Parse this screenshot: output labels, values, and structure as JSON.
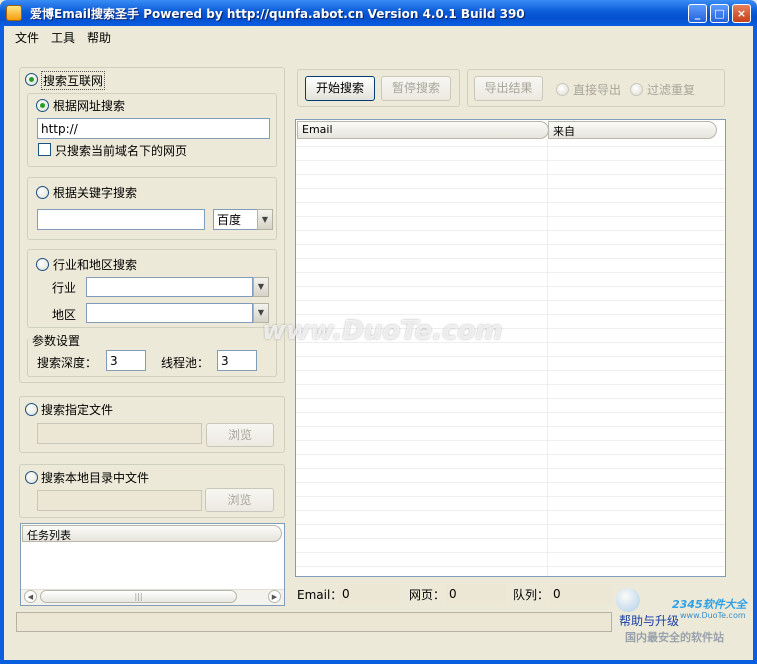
{
  "window": {
    "title": "爱博Email搜索圣手 Powered by http://qunfa.abot.cn Version 4.0.1 Build 390"
  },
  "menu": [
    "文件",
    "工具",
    "帮助"
  ],
  "search_internet": {
    "label": "搜索互联网",
    "selected": true,
    "by_url": {
      "label": "根据网址搜索",
      "selected": true,
      "url_value": "http://",
      "domain_only_label": "只搜索当前域名下的网页",
      "domain_only_checked": false
    },
    "by_keyword": {
      "label": "根据关键字搜索",
      "selected": false,
      "keyword_value": "",
      "engine_value": "百度"
    },
    "by_industry": {
      "label": "行业和地区搜索",
      "selected": false,
      "industry_label": "行业",
      "industry_value": "",
      "region_label": "地区",
      "region_value": ""
    },
    "params": {
      "title": "参数设置",
      "depth_label": "搜索深度：",
      "depth_value": "3",
      "threads_label": "线程池：",
      "threads_value": "3"
    }
  },
  "search_file": {
    "label": "搜索指定文件",
    "selected": false,
    "path_value": "",
    "browse_label": "浏览"
  },
  "search_dir": {
    "label": "搜索本地目录中文件",
    "selected": false,
    "path_value": "",
    "browse_label": "浏览"
  },
  "task_list": {
    "header": "任务列表"
  },
  "toolbar": {
    "start_label": "开始搜索",
    "pause_label": "暂停搜索",
    "export_label": "导出结果",
    "direct_export_label": "直接导出",
    "filter_dup_label": "过滤重复"
  },
  "results": {
    "columns": [
      "Email",
      "来自"
    ],
    "rows": []
  },
  "status": {
    "email_label": "Email：",
    "email_value": "0",
    "pages_label": "网页：",
    "pages_value": "0",
    "queue_label": "队列：",
    "queue_value": "0"
  },
  "help_link": "帮助与升级",
  "watermark": {
    "main": "www.DuoTe.com",
    "logo": "2345软件大全",
    "logo_url": "www.DuoTe.com",
    "slogan": "国内最安全的软件站"
  },
  "colors": {
    "titlebar": "#0b5bd8",
    "frame": "#0a5ee0",
    "window_bg": "#ece9d8",
    "radio_dot": "#21a121"
  }
}
